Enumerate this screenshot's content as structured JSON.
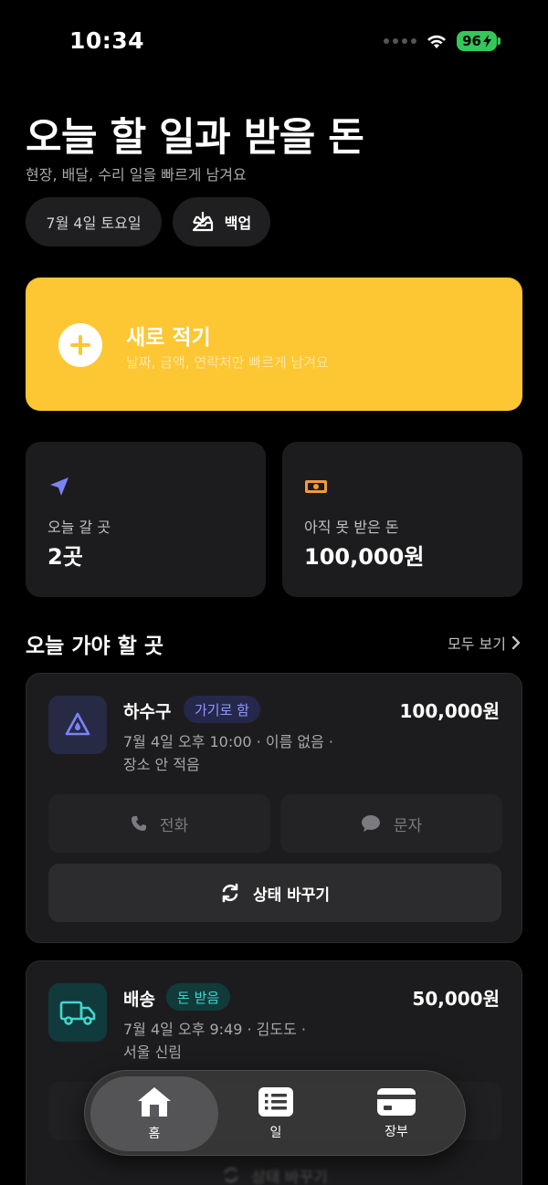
{
  "status_bar": {
    "time": "10:34",
    "battery": "96"
  },
  "header": {
    "title": "오늘 할 일과 받을 돈",
    "subtitle": "현장, 배달, 수리 일을 빠르게 남겨요",
    "date_chip": "7월 4일 토요일",
    "backup_label": "백업"
  },
  "add_card": {
    "title": "새로 적기",
    "subtitle": "날짜, 금액, 연락처만 빠르게 남겨요",
    "accent": "#fdc633"
  },
  "stats": {
    "places_label": "오늘 갈 곳",
    "places_value": "2곳",
    "unpaid_label": "아직 못 받은 돈",
    "unpaid_value": "100,000원"
  },
  "section": {
    "title": "오늘 가야 할 곳",
    "see_all": "모두 보기"
  },
  "jobs": [
    {
      "name": "하수구",
      "badge": "가기로 함",
      "amount": "100,000원",
      "meta_line1": "7월 4일 오후 10:00 · 이름 없음 ·",
      "meta_line2": "장소 안 적음",
      "call_label": "전화",
      "sms_label": "문자",
      "status_label": "상태 바꾸기"
    },
    {
      "name": "배송",
      "badge": "돈 받음",
      "amount": "50,000원",
      "meta_line1": "7월 4일 오후 9:49 · 김도도 ·",
      "meta_line2": "서울 신림",
      "status_label": "상태 바꾸기"
    }
  ],
  "tabs": [
    {
      "label": "홈"
    },
    {
      "label": "일"
    },
    {
      "label": "장부"
    }
  ]
}
